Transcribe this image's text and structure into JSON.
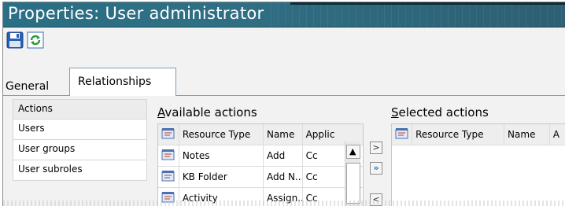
{
  "window": {
    "title": "Properties: User administrator"
  },
  "toolbar": {
    "save_icon": "floppy-disk-save-icon",
    "refresh_icon": "refresh-icon"
  },
  "tabs": [
    {
      "label": "General",
      "active": false
    },
    {
      "label": "Relationships",
      "active": true
    }
  ],
  "sidebar": {
    "items": [
      {
        "label": "Actions",
        "active": true
      },
      {
        "label": "Users"
      },
      {
        "label": "User groups"
      },
      {
        "label": "User subroles"
      }
    ]
  },
  "available": {
    "title_prefix": "A",
    "title_rest": "vailable actions",
    "columns": [
      "Resource Type",
      "Name",
      "Applic"
    ],
    "rows": [
      {
        "type": "Notes",
        "name": "Add",
        "app": "Cc"
      },
      {
        "type": "KB Folder",
        "name": "Add N...",
        "app": "Cc"
      },
      {
        "type": "Activity",
        "name": "Assign...",
        "app": "Cc"
      }
    ]
  },
  "selected": {
    "title_prefix": "S",
    "title_rest": "elected actions",
    "columns": [
      "Resource Type",
      "Name",
      "A"
    ]
  },
  "move_buttons": {
    "add": ">",
    "add_all": "»",
    "remove": "<"
  },
  "colors": {
    "titlebar": "#2f6f84",
    "tab_border": "#7f9db9",
    "accent_blue": "#1d6fd0"
  }
}
